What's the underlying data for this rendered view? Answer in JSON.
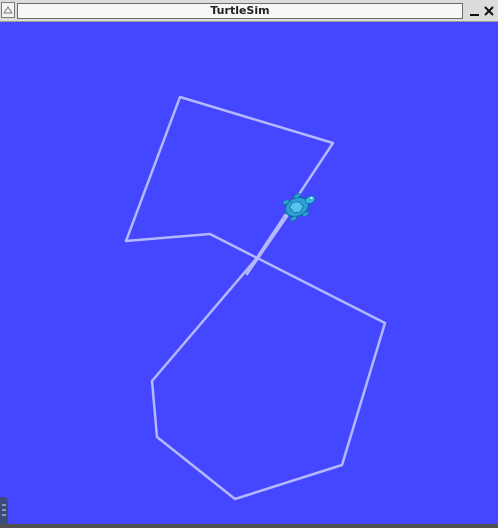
{
  "window": {
    "title": "TurtleSim",
    "background": "#4546ff"
  },
  "titlebar": {
    "menu_icon": "window-menu-icon",
    "minimize_icon": "minimize-icon",
    "close_icon": "close-icon"
  },
  "canvas": {
    "pen_color": "#b3b8ff",
    "turtle_icon": "turtle-icon"
  }
}
